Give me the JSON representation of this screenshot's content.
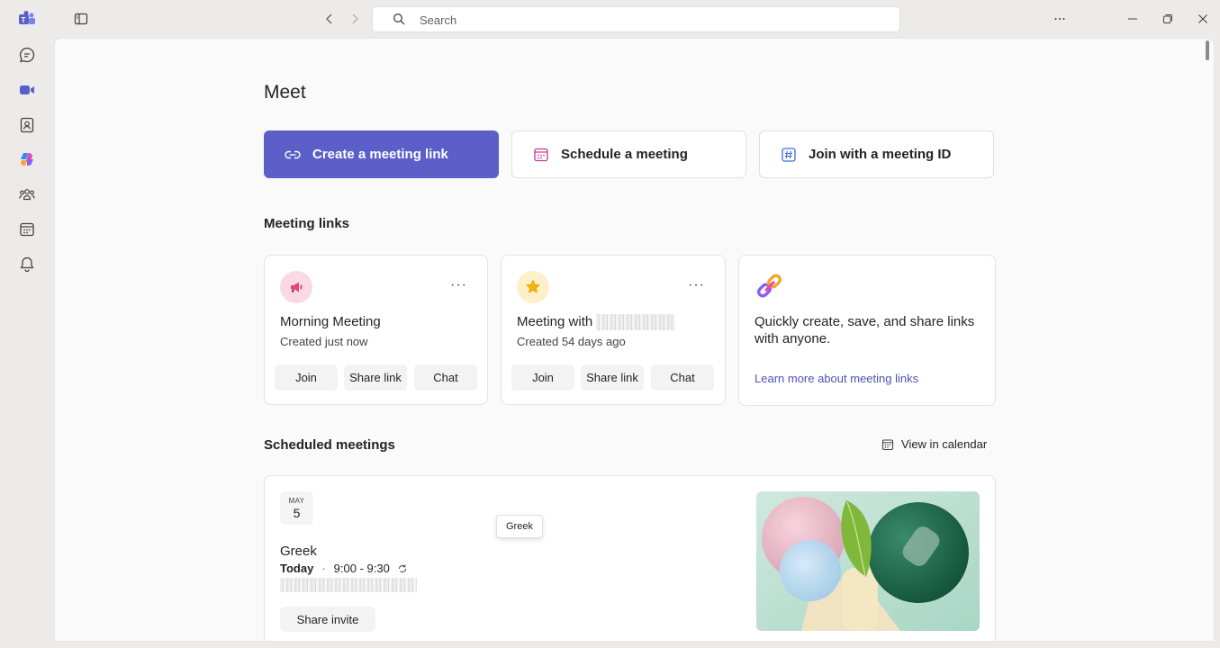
{
  "search": {
    "placeholder": "Search"
  },
  "page": {
    "title": "Meet"
  },
  "actions": [
    {
      "label": "Create a meeting link",
      "icon": "link-icon"
    },
    {
      "label": "Schedule a meeting",
      "icon": "calendar-icon"
    },
    {
      "label": "Join with a meeting ID",
      "icon": "hashtag-icon"
    }
  ],
  "meeting_links": {
    "title": "Meeting links",
    "cards": [
      {
        "title": "Morning Meeting",
        "subtitle": "Created just now",
        "buttons": [
          "Join",
          "Share link",
          "Chat"
        ],
        "icon": "megaphone-icon"
      },
      {
        "title": "Meeting with",
        "subtitle": "Created 54 days ago",
        "buttons": [
          "Join",
          "Share link",
          "Chat"
        ],
        "icon": "star-icon"
      }
    ],
    "promo": {
      "text": "Quickly create, save, and share links with anyone.",
      "link": "Learn more about meeting links"
    }
  },
  "scheduled": {
    "title": "Scheduled meetings",
    "view_calendar": "View in calendar",
    "meeting": {
      "month": "MAY",
      "day": "5",
      "title": "Greek",
      "when_label": "Today",
      "time": "9:00 - 9:30",
      "share_label": "Share invite",
      "tooltip": "Greek"
    }
  },
  "colors": {
    "accent": "#5b5fc7",
    "link": "#4f52b2"
  }
}
